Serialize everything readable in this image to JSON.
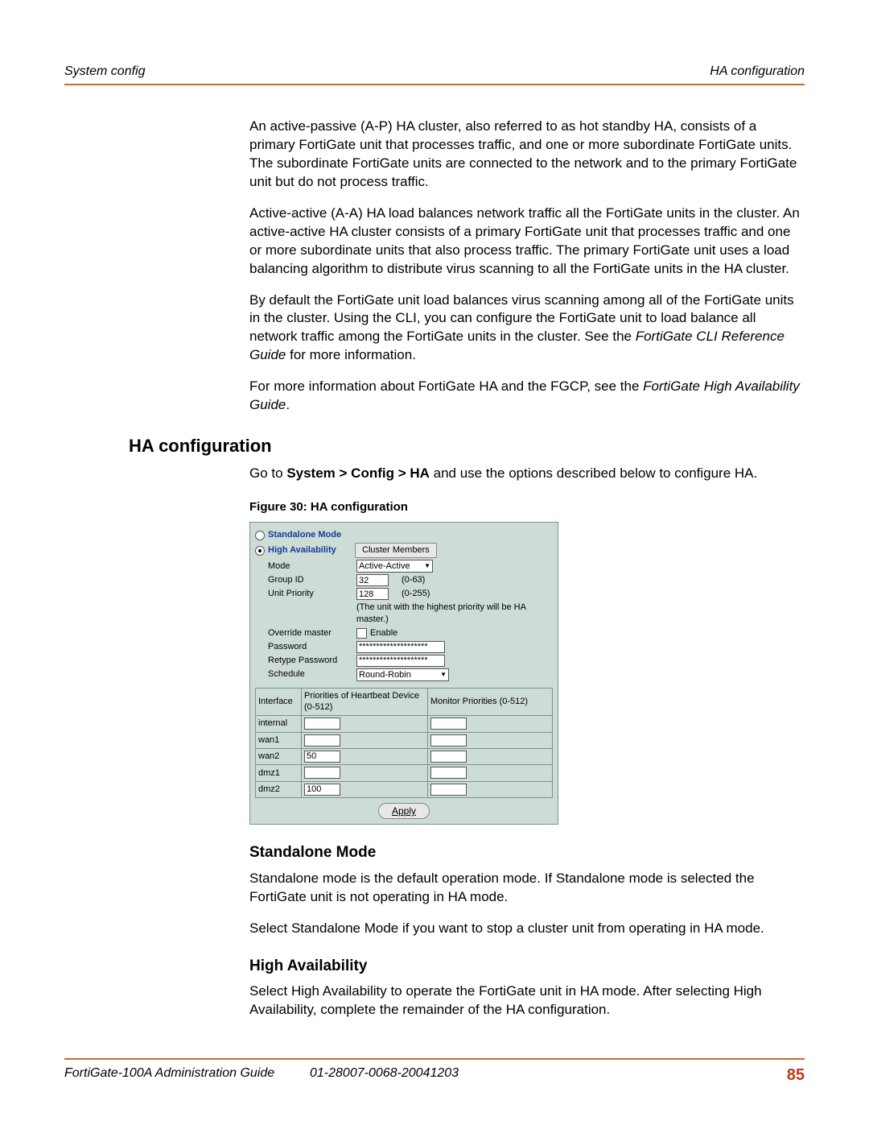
{
  "header": {
    "left": "System config",
    "right": "HA configuration"
  },
  "body": {
    "p1": "An active-passive (A-P) HA cluster, also referred to as hot standby HA, consists of a primary FortiGate unit that processes traffic, and one or more subordinate FortiGate units. The subordinate FortiGate units are connected to the network and to the primary FortiGate unit but do not process traffic.",
    "p2": "Active-active (A-A) HA load balances network traffic all the FortiGate units in the cluster. An active-active HA cluster consists of a primary FortiGate unit that processes traffic and one or more subordinate units that also process traffic. The primary FortiGate unit uses a load balancing algorithm to distribute virus scanning to all the FortiGate units in the HA cluster.",
    "p3a": "By default the FortiGate unit load balances virus scanning among all of the FortiGate units in the cluster. Using the CLI, you can configure the FortiGate unit to load balance all network traffic among the FortiGate units in the cluster. See the ",
    "p3i": "FortiGate CLI Reference Guide",
    "p3b": " for more information.",
    "p4a": "For more information about FortiGate HA and the FGCP, see the ",
    "p4i": "FortiGate High Availability Guide",
    "p4b": "."
  },
  "section_heading": "HA configuration",
  "nav_line": {
    "a": "Go to ",
    "b": "System > Config > HA",
    "c": " and use the options described below to configure HA."
  },
  "fig_caption": "Figure 30: HA configuration",
  "ui": {
    "radio_standalone": "Standalone Mode",
    "radio_ha": "High Availability",
    "cluster_members_btn": "Cluster Members",
    "mode_label": "Mode",
    "mode_value": "Active-Active",
    "group_label": "Group ID",
    "group_value": "32",
    "group_range": "(0-63)",
    "priority_label": "Unit Priority",
    "priority_value": "128",
    "priority_range": "(0-255)",
    "priority_note": "(The unit with the highest priority will be HA master.)",
    "override_label": "Override master",
    "override_cb": "Enable",
    "password_label": "Password",
    "password_value": "********************",
    "repassword_label": "Retype Password",
    "repassword_value": "********************",
    "schedule_label": "Schedule",
    "schedule_value": "Round-Robin",
    "grid": {
      "col_interface": "Interface",
      "col_heartbeat": "Priorities of Heartbeat Device (0-512)",
      "col_monitor": "Monitor Priorities (0-512)",
      "rows": [
        {
          "iface": "internal",
          "hb": "",
          "mon": ""
        },
        {
          "iface": "wan1",
          "hb": "",
          "mon": ""
        },
        {
          "iface": "wan2",
          "hb": "50",
          "mon": ""
        },
        {
          "iface": "dmz1",
          "hb": "",
          "mon": ""
        },
        {
          "iface": "dmz2",
          "hb": "100",
          "mon": ""
        }
      ]
    },
    "apply": "Apply"
  },
  "standalone": {
    "heading": "Standalone Mode",
    "p1": "Standalone mode is the default operation mode. If Standalone mode is selected the FortiGate unit is not operating in HA mode.",
    "p2": "Select Standalone Mode if you want to stop a cluster unit from operating in HA mode."
  },
  "ha": {
    "heading": "High Availability",
    "p1": "Select High Availability to operate the FortiGate unit in HA mode. After selecting High Availability, complete the remainder of the HA configuration."
  },
  "footer": {
    "left": "FortiGate-100A Administration Guide",
    "center": "01-28007-0068-20041203",
    "page": "85"
  }
}
